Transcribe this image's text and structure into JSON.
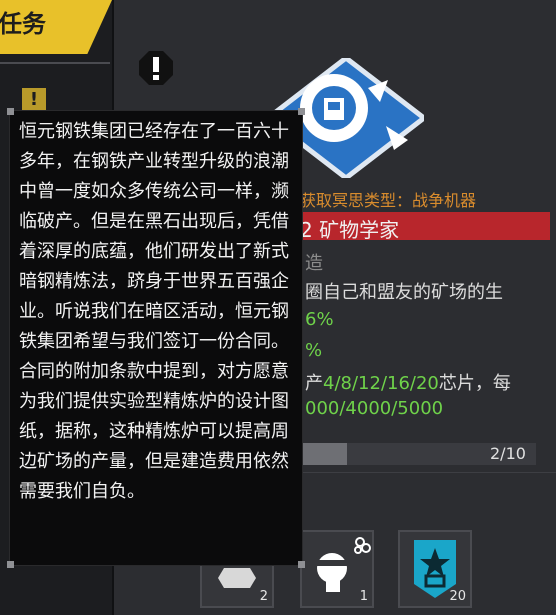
{
  "left_panel": {
    "tab_title": "任务"
  },
  "mission": {
    "type_line": "获取冥思类型：战争机器",
    "title": "2 矿物学家",
    "build_line": "造",
    "desc_line": "圈自己和盟友的矿场的生",
    "percent_1": "6%",
    "percent_2": "%",
    "chip_prefix": "产",
    "chip_values": "4/8/12/16/20",
    "chip_suffix": "芯片，每",
    "cost_line": "000/4000/5000",
    "progress": {
      "text": "2/10",
      "value": 2,
      "max": 10
    }
  },
  "slots": [
    {
      "count": "2",
      "icon": "gear-icon"
    },
    {
      "count": "1",
      "icon": "head-gear-icon"
    },
    {
      "count": "20",
      "icon": "star-badge-icon"
    }
  ],
  "tooltip": {
    "text": "恒元钢铁集团已经存在了一百六十多年，在钢铁产业转型升级的浪潮中曾一度如众多传统公司一样，濒临破产。但是在黑石出现后，凭借着深厚的底蕴，他们研发出了新式暗钢精炼法，跻身于世界五百强企业。听说我们在暗区活动，恒元钢铁集团希望与我们签订一份合同。合同的附加条款中提到，对方愿意为我们提供实验型精炼炉的设计图纸，据称，这种精炼炉可以提高周边矿场的产量，但是建造费用依然需要我们自负。"
  },
  "colors": {
    "accent_yellow": "#e8c12a",
    "title_red": "#b8262c",
    "value_green": "#6fd24a",
    "type_orange": "#d98c2d",
    "emblem_blue": "#2a73c4"
  }
}
